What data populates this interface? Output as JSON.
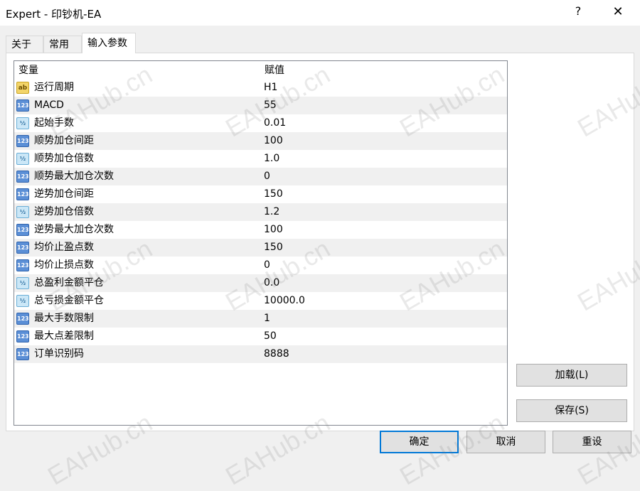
{
  "window": {
    "title": "Expert - 印钞机-EA",
    "help_glyph": "?",
    "close_glyph": "✕"
  },
  "tabs": [
    {
      "label": "关于"
    },
    {
      "label": "常用"
    },
    {
      "label": "输入参数"
    }
  ],
  "active_tab": "输入参数",
  "table": {
    "headers": {
      "variable": "变量",
      "value": "赋值"
    },
    "rows": [
      {
        "icon": "string-type-icon",
        "icon_text": "ab",
        "name": "运行周期",
        "value": "H1"
      },
      {
        "icon": "integer-type-icon",
        "icon_text": "123",
        "name": "MACD",
        "value": "55"
      },
      {
        "icon": "double-type-icon",
        "icon_text": "½",
        "name": "起始手数",
        "value": "0.01"
      },
      {
        "icon": "integer-type-icon",
        "icon_text": "123",
        "name": "顺势加仓间距",
        "value": "100"
      },
      {
        "icon": "double-type-icon",
        "icon_text": "½",
        "name": "顺势加仓倍数",
        "value": "1.0"
      },
      {
        "icon": "integer-type-icon",
        "icon_text": "123",
        "name": "顺势最大加仓次数",
        "value": "0"
      },
      {
        "icon": "integer-type-icon",
        "icon_text": "123",
        "name": "逆势加仓间距",
        "value": "150"
      },
      {
        "icon": "double-type-icon",
        "icon_text": "½",
        "name": "逆势加仓倍数",
        "value": "1.2"
      },
      {
        "icon": "integer-type-icon",
        "icon_text": "123",
        "name": "逆势最大加仓次数",
        "value": "100"
      },
      {
        "icon": "integer-type-icon",
        "icon_text": "123",
        "name": "均价止盈点数",
        "value": "150"
      },
      {
        "icon": "integer-type-icon",
        "icon_text": "123",
        "name": "均价止损点数",
        "value": "0"
      },
      {
        "icon": "double-type-icon",
        "icon_text": "½",
        "name": "总盈利金额平仓",
        "value": "0.0"
      },
      {
        "icon": "double-type-icon",
        "icon_text": "½",
        "name": "总亏损金额平仓",
        "value": "10000.0"
      },
      {
        "icon": "integer-type-icon",
        "icon_text": "123",
        "name": "最大手数限制",
        "value": "1"
      },
      {
        "icon": "integer-type-icon",
        "icon_text": "123",
        "name": "最大点差限制",
        "value": "50"
      },
      {
        "icon": "integer-type-icon",
        "icon_text": "123",
        "name": "订单识别码",
        "value": "8888"
      }
    ]
  },
  "side_buttons": {
    "load": "加载(L)",
    "save": "保存(S)"
  },
  "footer_buttons": {
    "ok": "确定",
    "cancel": "取消",
    "reset": "重设"
  },
  "watermark": "EAHub.cn",
  "colors": {
    "accent": "#0078d7",
    "row_alt": "#f0f0f0",
    "button_face": "#e1e1e1",
    "integer_icon": "#5b8fd6",
    "double_icon": "#cbe7f7",
    "string_icon": "#f3d56a"
  }
}
